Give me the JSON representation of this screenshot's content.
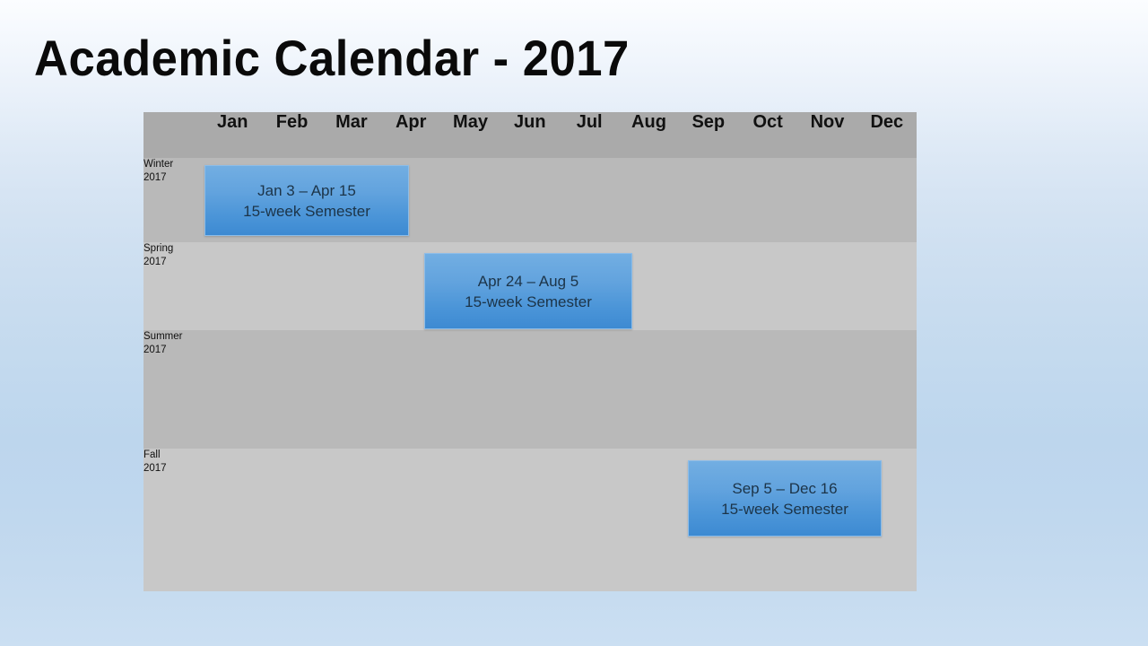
{
  "slide": {
    "title": "Academic Calendar - 2017",
    "background_top_color": "#fbfdff",
    "background_bottom_color": "#c4daef"
  },
  "table": {
    "corner_header": "",
    "month_headers": [
      "Jan",
      "Feb",
      "Mar",
      "Apr",
      "May",
      "Jun",
      "Jul",
      "Aug",
      "Sep",
      "Oct",
      "Nov",
      "Dec"
    ],
    "header_background": "#aaaaaa",
    "row_dark_background": "#b9b9b9",
    "row_light_background": "#c8c8c8",
    "rows": [
      {
        "label": "Winter\n2017"
      },
      {
        "label": "Spring\n2017"
      },
      {
        "label": "Summer\n2017"
      },
      {
        "label": "Fall\n2017"
      }
    ]
  },
  "semesters": [
    {
      "term": "Winter 2017",
      "dates": "Jan 3 – Apr 15",
      "duration": "15-week Semester",
      "start_month": "Jan",
      "end_month": "Apr",
      "bar_color": "#4b95d8"
    },
    {
      "term": "Spring 2017",
      "dates": "Apr 24 – Aug 5",
      "duration": "15-week Semester",
      "start_month": "Apr",
      "end_month": "Aug",
      "bar_color": "#4b95d8"
    },
    {
      "term": "Summer 2017",
      "dates": "",
      "duration": "",
      "start_month": "",
      "end_month": "",
      "bar_color": ""
    },
    {
      "term": "Fall 2017",
      "dates": "Sep 5 – Dec 16",
      "duration": "15-week Semester",
      "start_month": "Sep",
      "end_month": "Dec",
      "bar_color": "#4b95d8"
    }
  ]
}
